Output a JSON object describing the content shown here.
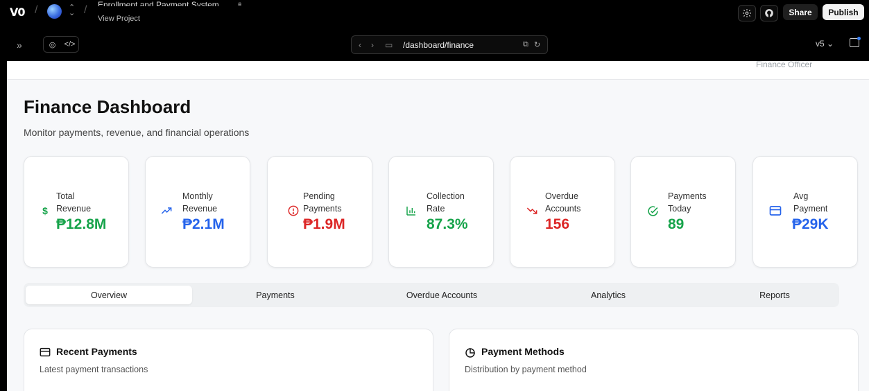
{
  "topbar": {
    "logo": "V0",
    "project_title": "Enrollment and Payment System",
    "view_project": "View Project",
    "share_label": "Share",
    "publish_label": "Publish",
    "icons": [
      "settings-icon",
      "github-icon"
    ]
  },
  "toolbar": {
    "url": "/dashboard/finance",
    "version": "v5"
  },
  "header": {
    "role": "Finance Officer"
  },
  "page": {
    "title": "Finance Dashboard",
    "subtitle": "Monitor payments, revenue, and financial operations"
  },
  "stats": [
    {
      "label_line1": "Total",
      "label_line2": "Revenue",
      "value": "₱12.8M",
      "color": "#16a34a",
      "icon": "dollar-icon"
    },
    {
      "label_line1": "Monthly",
      "label_line2": "Revenue",
      "value": "₱2.1M",
      "color": "#2563eb",
      "icon": "trending-up-icon"
    },
    {
      "label_line1": "Pending",
      "label_line2": "Payments",
      "value": "₱1.9M",
      "color": "#dc2626",
      "icon": "alert-circle-icon"
    },
    {
      "label_line1": "Collection",
      "label_line2": "Rate",
      "value": "87.3%",
      "color": "#16a34a",
      "icon": "bar-chart-icon"
    },
    {
      "label_line1": "Overdue",
      "label_line2": "Accounts",
      "value": "156",
      "color": "#dc2626",
      "icon": "trending-down-icon"
    },
    {
      "label_line1": "Payments",
      "label_line2": "Today",
      "value": "89",
      "color": "#16a34a",
      "icon": "check-circle-icon"
    },
    {
      "label_line1": "Avg",
      "label_line2": "Payment",
      "value": "₱29K",
      "color": "#2563eb",
      "icon": "credit-card-icon"
    }
  ],
  "tabs": [
    "Overview",
    "Payments",
    "Overdue Accounts",
    "Analytics",
    "Reports"
  ],
  "active_tab": "Overview",
  "panels": [
    {
      "title": "Recent Payments",
      "subtitle": "Latest payment transactions",
      "icon": "credit-card-icon"
    },
    {
      "title": "Payment Methods",
      "subtitle": "Distribution by payment method",
      "icon": "pie-chart-icon"
    }
  ]
}
